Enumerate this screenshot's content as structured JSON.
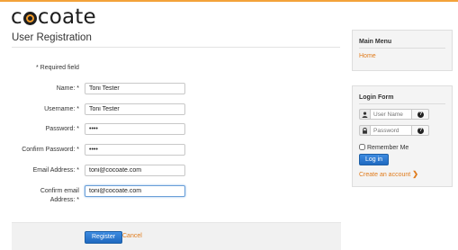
{
  "brand": {
    "logo_text_pre": "c",
    "logo_text_post": "coate"
  },
  "page": {
    "title": "User Registration",
    "required_note": "* Required field"
  },
  "form": {
    "fields": [
      {
        "label": "Name: *",
        "value": "Toni Tester",
        "type": "text"
      },
      {
        "label": "Username: *",
        "value": "Toni Tester",
        "type": "text"
      },
      {
        "label": "Password: *",
        "value": "••••",
        "type": "text"
      },
      {
        "label": "Confirm Password: *",
        "value": "••••",
        "type": "text"
      },
      {
        "label": "Email Address: *",
        "value": "toni@cocoate.com",
        "type": "text"
      },
      {
        "label_line1": "Confirm email",
        "label_line2": "Address: *",
        "value": "toni@cocoate.com",
        "type": "text"
      }
    ],
    "register_label": "Register",
    "cancel_label": "Cancel"
  },
  "sidebar": {
    "main_menu": {
      "title": "Main Menu",
      "home_label": "Home"
    },
    "login_form": {
      "title": "Login Form",
      "username_placeholder": "User Name",
      "password_placeholder": "Password",
      "remember_label": "Remember Me",
      "login_label": "Log in",
      "create_account_label": "Create an account",
      "create_chevron": "❯"
    }
  },
  "colors": {
    "accent": "#e07b1b",
    "top_line": "#f3a23a",
    "button": "#2672c8"
  }
}
